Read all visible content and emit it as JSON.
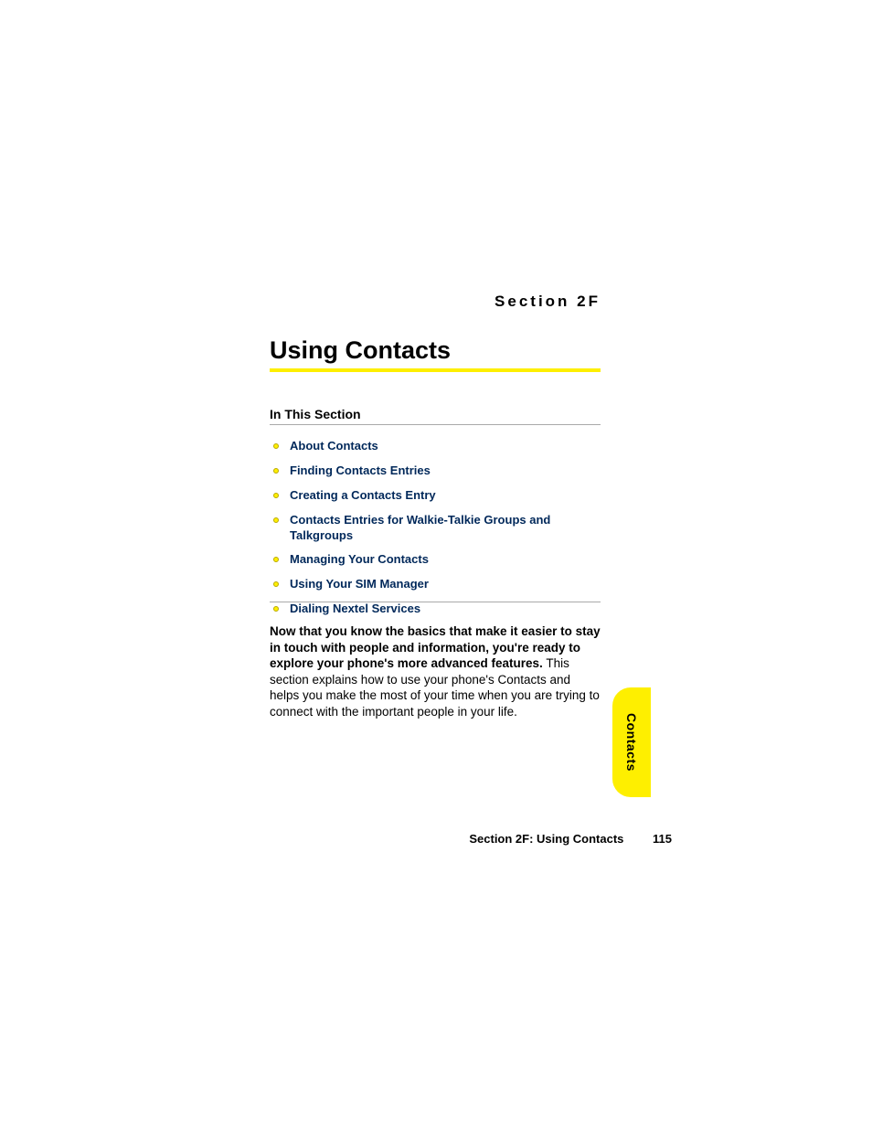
{
  "section_label": "Section 2F",
  "title": "Using Contacts",
  "subhead": "In This Section",
  "toc": [
    "About Contacts",
    "Finding Contacts Entries",
    "Creating a Contacts Entry",
    "Contacts Entries for Walkie-Talkie Groups and Talkgroups",
    "Managing Your Contacts",
    "Using Your SIM Manager",
    "Dialing Nextel Services"
  ],
  "para_bold": "Now that you know the basics that make it easier to stay in touch with people and information, you're ready to explore your phone's more advanced features.",
  "para_rest": " This section explains how to use your phone's Contacts and helps you make the most of your time when you are trying to connect with the important people in your life.",
  "tab_label": "Contacts",
  "footer_text": "Section 2F: Using Contacts",
  "page_number": "115"
}
